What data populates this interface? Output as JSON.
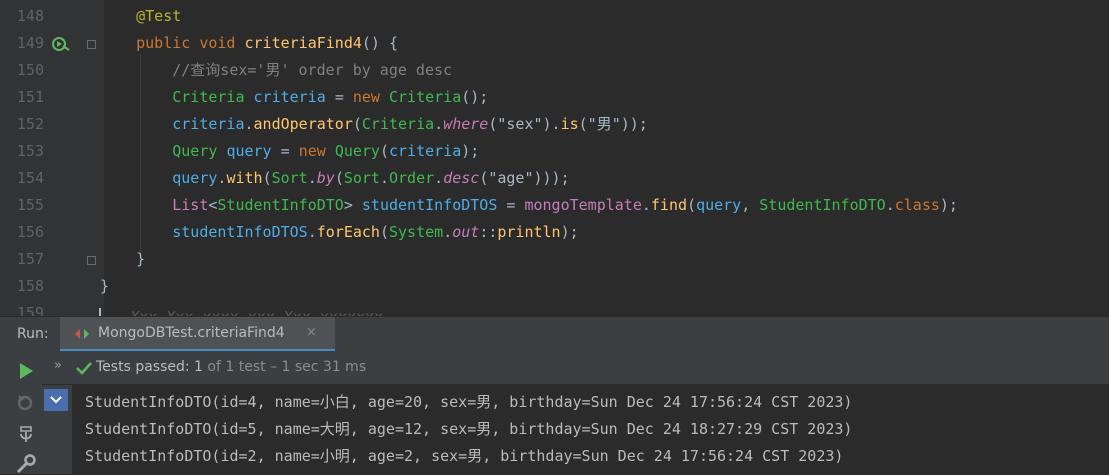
{
  "editor": {
    "line_numbers": [
      "148",
      "149",
      "150",
      "151",
      "152",
      "153",
      "154",
      "155",
      "156",
      "157",
      "158",
      "159"
    ],
    "lines": [
      [
        {
          "t": "    ",
          "c": "plain"
        },
        {
          "t": "@Test",
          "c": "ann"
        }
      ],
      [
        {
          "t": "    ",
          "c": "plain"
        },
        {
          "t": "public void ",
          "c": "kw"
        },
        {
          "t": "criteriaFind4",
          "c": "fn"
        },
        {
          "t": "() {",
          "c": "plain"
        }
      ],
      [
        {
          "t": "        //查询sex='男' order by age desc",
          "c": "cmt"
        }
      ],
      [
        {
          "t": "        ",
          "c": "plain"
        },
        {
          "t": "Criteria ",
          "c": "grn"
        },
        {
          "t": "criteria ",
          "c": "cls"
        },
        {
          "t": "= ",
          "c": "plain"
        },
        {
          "t": "new ",
          "c": "kw"
        },
        {
          "t": "Criteria",
          "c": "grn"
        },
        {
          "t": "();",
          "c": "plain"
        }
      ],
      [
        {
          "t": "        ",
          "c": "plain"
        },
        {
          "t": "criteria",
          "c": "cls"
        },
        {
          "t": ".",
          "c": "plain"
        },
        {
          "t": "andOperator",
          "c": "fn"
        },
        {
          "t": "(",
          "c": "plain"
        },
        {
          "t": "Criteria",
          "c": "grn"
        },
        {
          "t": ".",
          "c": "plain"
        },
        {
          "t": "where",
          "c": "purp it"
        },
        {
          "t": "(\"sex\").",
          "c": "plain"
        },
        {
          "t": "is",
          "c": "fn"
        },
        {
          "t": "(\"男\"));",
          "c": "plain"
        }
      ],
      [
        {
          "t": "        ",
          "c": "plain"
        },
        {
          "t": "Query ",
          "c": "grn"
        },
        {
          "t": "query ",
          "c": "cls"
        },
        {
          "t": "= ",
          "c": "plain"
        },
        {
          "t": "new ",
          "c": "kw"
        },
        {
          "t": "Query",
          "c": "grn"
        },
        {
          "t": "(",
          "c": "plain"
        },
        {
          "t": "criteria",
          "c": "cls"
        },
        {
          "t": ");",
          "c": "plain"
        }
      ],
      [
        {
          "t": "        ",
          "c": "plain"
        },
        {
          "t": "query",
          "c": "cls"
        },
        {
          "t": ".",
          "c": "plain"
        },
        {
          "t": "with",
          "c": "fn"
        },
        {
          "t": "(",
          "c": "plain"
        },
        {
          "t": "Sort",
          "c": "grn"
        },
        {
          "t": ".",
          "c": "plain"
        },
        {
          "t": "by",
          "c": "purp it"
        },
        {
          "t": "(",
          "c": "plain"
        },
        {
          "t": "Sort",
          "c": "grn"
        },
        {
          "t": ".",
          "c": "plain"
        },
        {
          "t": "Order",
          "c": "grn"
        },
        {
          "t": ".",
          "c": "plain"
        },
        {
          "t": "desc",
          "c": "purp it"
        },
        {
          "t": "(\"age\")));",
          "c": "plain"
        }
      ],
      [
        {
          "t": "        ",
          "c": "plain"
        },
        {
          "t": "List",
          "c": "purp"
        },
        {
          "t": "<",
          "c": "plain"
        },
        {
          "t": "StudentInfoDTO",
          "c": "grn"
        },
        {
          "t": "> ",
          "c": "plain"
        },
        {
          "t": "studentInfoDTOS ",
          "c": "cls"
        },
        {
          "t": "= ",
          "c": "plain"
        },
        {
          "t": "mongoTemplate",
          "c": "purp"
        },
        {
          "t": ".",
          "c": "plain"
        },
        {
          "t": "find",
          "c": "fn"
        },
        {
          "t": "(",
          "c": "plain"
        },
        {
          "t": "query",
          "c": "cls"
        },
        {
          "t": ", ",
          "c": "plain"
        },
        {
          "t": "StudentInfoDTO",
          "c": "grn"
        },
        {
          "t": ".",
          "c": "plain"
        },
        {
          "t": "class",
          "c": "kw"
        },
        {
          "t": ");",
          "c": "plain"
        }
      ],
      [
        {
          "t": "        ",
          "c": "plain"
        },
        {
          "t": "studentInfoDTOS",
          "c": "cls"
        },
        {
          "t": ".",
          "c": "plain"
        },
        {
          "t": "forEach",
          "c": "fn"
        },
        {
          "t": "(",
          "c": "plain"
        },
        {
          "t": "System",
          "c": "grn"
        },
        {
          "t": ".",
          "c": "plain"
        },
        {
          "t": "out",
          "c": "purp it"
        },
        {
          "t": "::",
          "c": "plain"
        },
        {
          "t": "println",
          "c": "fn"
        },
        {
          "t": ");",
          "c": "plain"
        }
      ],
      [
        {
          "t": "    }",
          "c": "plain"
        }
      ],
      [
        {
          "t": "}",
          "c": "plain"
        }
      ]
    ],
    "partial_line": "Xxx Xxx xxxx xxx Xxx xxxxxxx"
  },
  "run_panel": {
    "label": "Run:",
    "tab_title": "MongoDBTest.criteriaFind4",
    "tab_close": "×",
    "status_label": "Tests passed: ",
    "status_count": "1",
    "status_detail": " of 1 test – 1 sec 31 ms",
    "expand_arrows": "»",
    "output": [
      "StudentInfoDTO(id=4, name=小白, age=20, sex=男, birthday=Sun Dec 24 17:56:24 CST 2023)",
      "StudentInfoDTO(id=5, name=大明, age=12, sex=男, birthday=Sun Dec 24 18:27:29 CST 2023)",
      "StudentInfoDTO(id=2, name=小明, age=2, sex=男, birthday=Sun Dec 24 17:56:24 CST 2023)"
    ]
  },
  "colors": {
    "editor_bg": "#2b2b2b",
    "gutter_bg": "#313335",
    "panel_bg": "#3c3f41",
    "pass_green": "#5fb85f",
    "accent_blue": "#4a88c7"
  },
  "icons": [
    "run-gutter-icon",
    "fold-icon",
    "run-tab-icon",
    "rerun-icon",
    "rerun-failed-icon",
    "toggle-icon",
    "settings-wrench-icon",
    "check-icon",
    "collapse-icon"
  ]
}
